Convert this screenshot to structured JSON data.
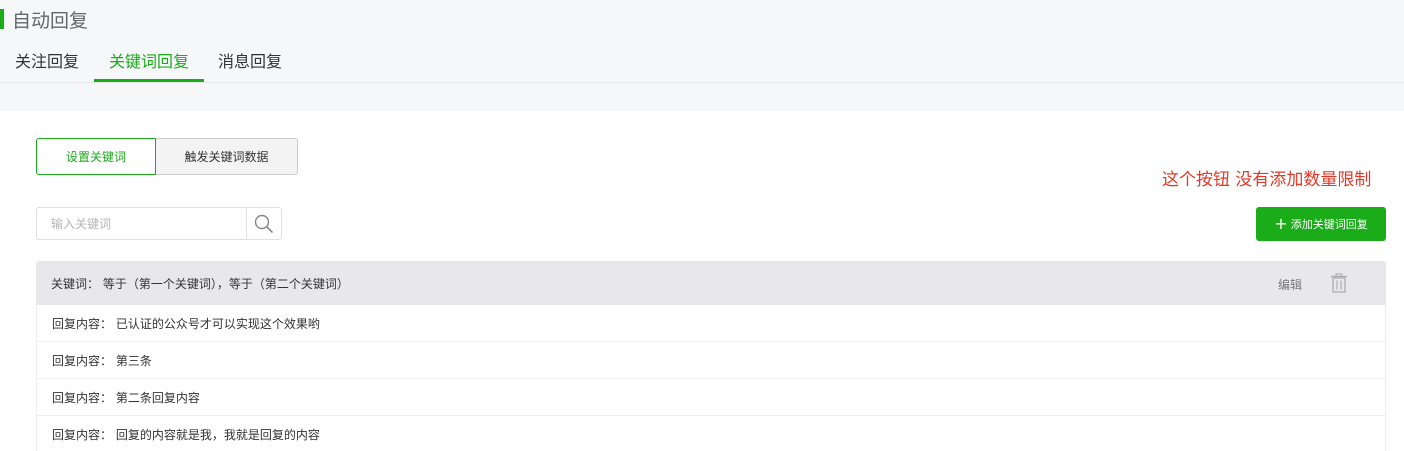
{
  "page": {
    "title": "自动回复"
  },
  "tabs": [
    {
      "label": "关注回复",
      "active": false
    },
    {
      "label": "关键词回复",
      "active": true
    },
    {
      "label": "消息回复",
      "active": false
    }
  ],
  "segmented": {
    "set_label": "设置关键词",
    "data_label": "触发关键词数据"
  },
  "annotation": "这个按钮 没有添加数量限制",
  "search": {
    "placeholder": "输入关键词",
    "value": "",
    "icon": "search-icon"
  },
  "add_button": {
    "icon": "plus-icon",
    "label": "添加关键词回复"
  },
  "rule": {
    "keywords_text": "关键词：   等于（第一个关键词），等于（第二个关键词）",
    "edit_label": "编辑",
    "delete_icon": "trash-icon",
    "replies": [
      "回复内容：  已认证的公众号才可以实现这个效果哟",
      "回复内容：  第三条",
      "回复内容：  第二条回复内容",
      "回复内容：  回复的内容就是我，我就是回复的内容"
    ]
  },
  "colors": {
    "accent": "#1aad19",
    "annotation": "#e13a2a",
    "header_bg": "#e8e8ec",
    "top_bg": "#f6f7f9"
  }
}
